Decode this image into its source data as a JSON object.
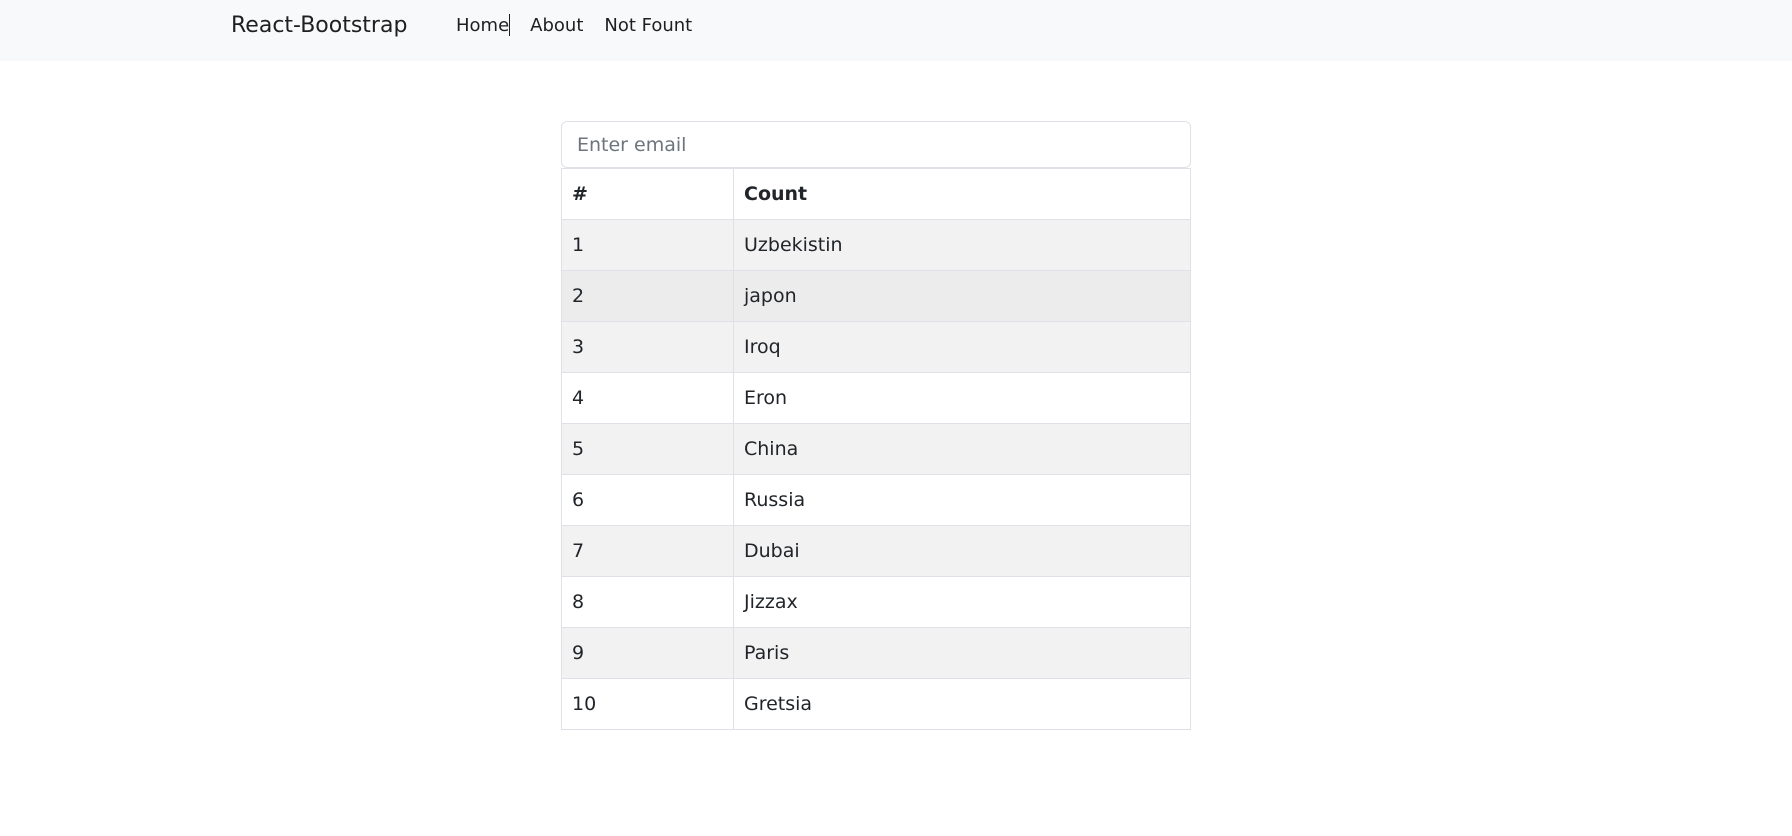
{
  "navbar": {
    "brand": "React-Bootstrap",
    "links": [
      {
        "label": "Home",
        "active": true
      },
      {
        "label": "About",
        "active": false
      },
      {
        "label": "Not Fount",
        "active": false
      }
    ]
  },
  "search": {
    "placeholder": "Enter email",
    "value": ""
  },
  "table": {
    "headers": [
      "#",
      "Count"
    ],
    "rows": [
      {
        "num": "1",
        "name": "Uzbekistin"
      },
      {
        "num": "2",
        "name": "japon"
      },
      {
        "num": "3",
        "name": "Iroq"
      },
      {
        "num": "4",
        "name": "Eron"
      },
      {
        "num": "5",
        "name": "China"
      },
      {
        "num": "6",
        "name": "Russia"
      },
      {
        "num": "7",
        "name": "Dubai"
      },
      {
        "num": "8",
        "name": "Jizzax"
      },
      {
        "num": "9",
        "name": "Paris"
      },
      {
        "num": "10",
        "name": "Gretsia"
      }
    ]
  },
  "colors": {
    "navbar_bg": "#f8f9fa",
    "stripe": "#f2f2f2",
    "hover": "#ececec",
    "border": "#dee2e6"
  }
}
